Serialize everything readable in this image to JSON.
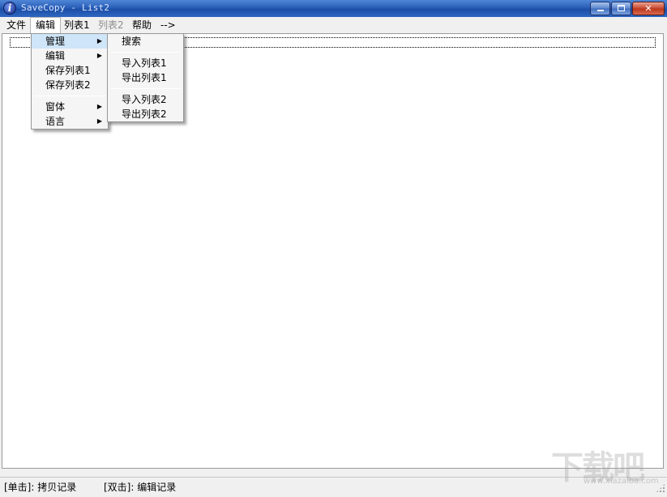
{
  "window": {
    "title": "SaveCopy - List2",
    "icon": "info-icon",
    "icon_glyph": "i",
    "colors": {
      "titlebar": "#2a5fb8",
      "close": "#c9462c",
      "highlight": "#cfe5f8"
    }
  },
  "menubar": {
    "items": [
      {
        "label": "文件"
      },
      {
        "label": "编辑"
      },
      {
        "label": "列表1"
      },
      {
        "label": "列表2"
      },
      {
        "label": "帮助"
      },
      {
        "label": "-->"
      }
    ]
  },
  "edit_menu": {
    "items": [
      {
        "label": "管理",
        "submenu": true,
        "highlighted": true
      },
      {
        "label": "编辑",
        "submenu": true
      },
      {
        "label": "保存列表1"
      },
      {
        "label": "保存列表2"
      },
      {
        "label": "窗体",
        "submenu": true
      },
      {
        "label": "语言",
        "submenu": true
      }
    ],
    "arrow": "▶"
  },
  "manage_submenu": {
    "items": [
      {
        "label": "搜索"
      },
      {
        "label": "导入列表1"
      },
      {
        "label": "导出列表1"
      },
      {
        "label": "导入列表2"
      },
      {
        "label": "导出列表2"
      }
    ]
  },
  "statusbar": {
    "single_click": "[单击]: 拷贝记录",
    "double_click": "[双击]: 编辑记录"
  },
  "watermark": {
    "logo_text": "下载吧",
    "url": "www.xiazaiba.com"
  }
}
